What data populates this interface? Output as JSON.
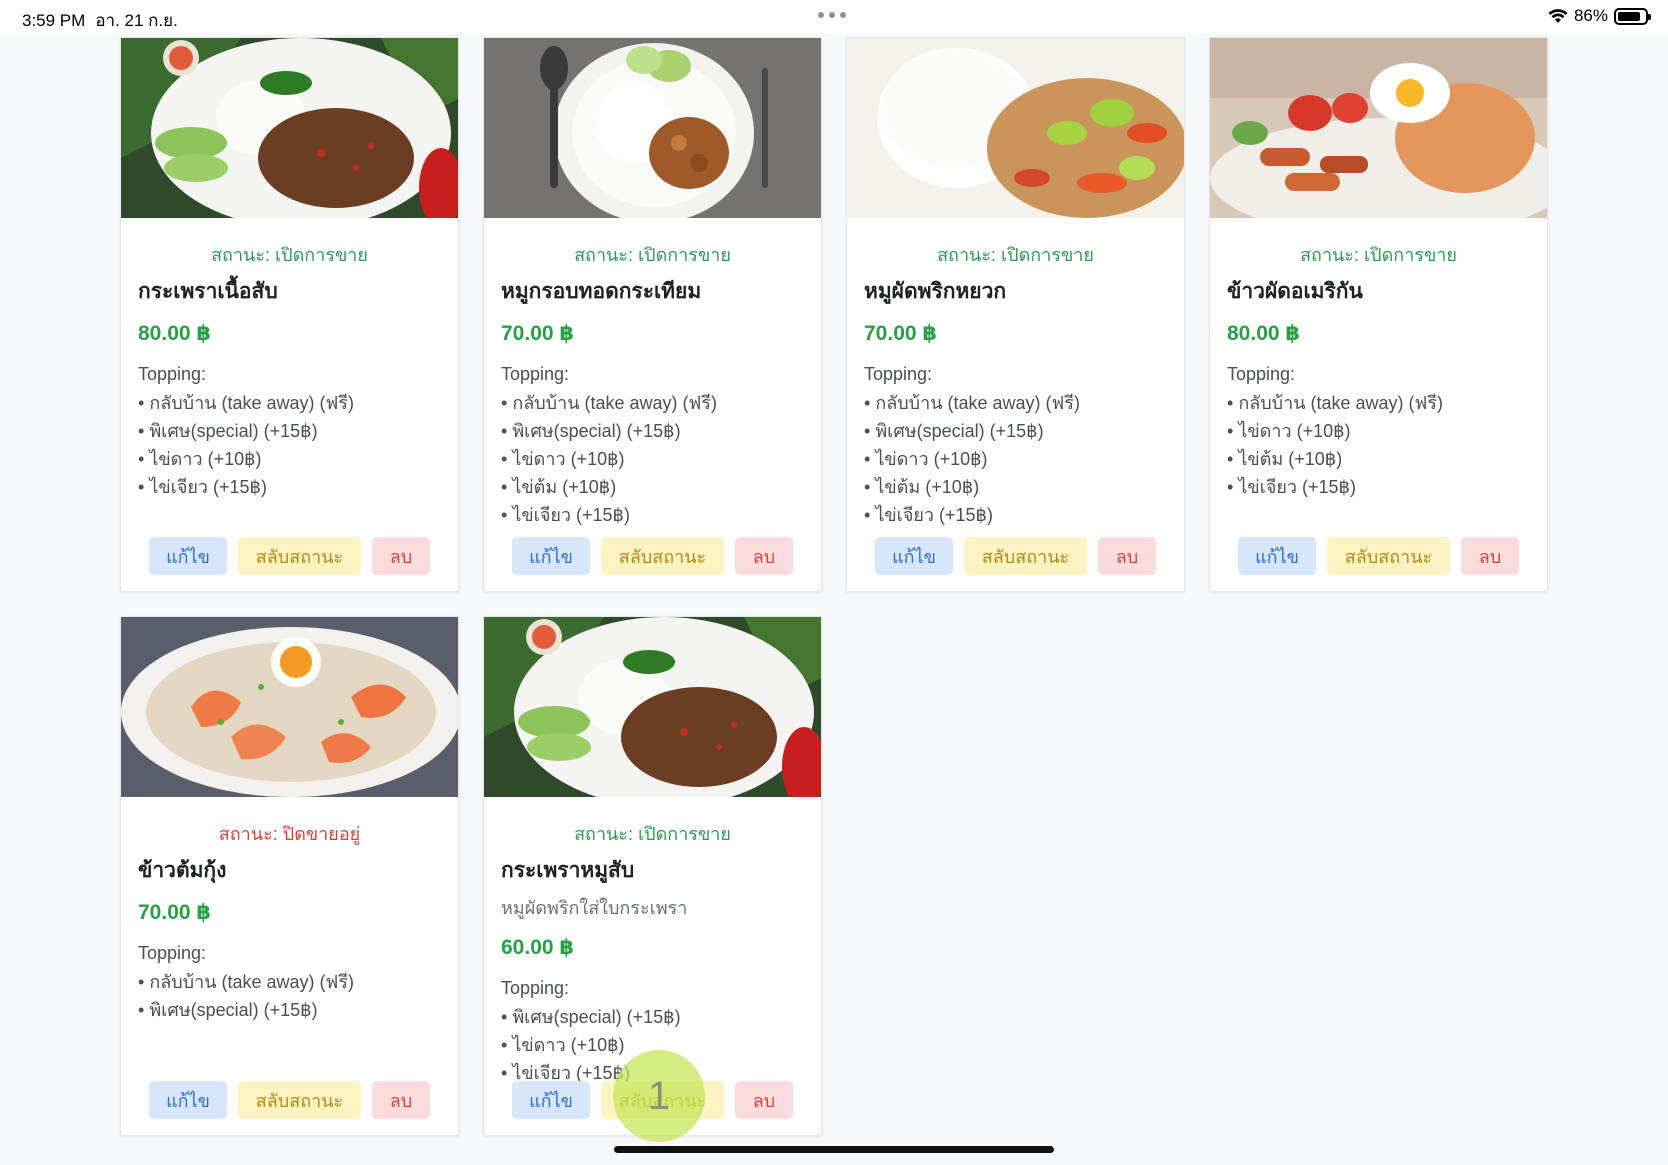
{
  "status_bar": {
    "time": "3:59 PM",
    "date": "อา. 21 ก.ย.",
    "battery": "86%",
    "battery_level": 0.86
  },
  "labels": {
    "topping": "Topping:",
    "edit": "แก้ไข",
    "toggle": "สลับสถานะ",
    "delete": "ลบ"
  },
  "menu_items": [
    {
      "status": "สถานะ: เปิดการขาย",
      "name": "กระเพราเนื้อสับ",
      "price": "80.00 ฿",
      "toppings": [
        "กลับบ้าน (take away) (ฟรี)",
        "พิเศษ(special) (+15฿)",
        "ไข่ดาว (+10฿)",
        "ไข่เจียว (+15฿)"
      ]
    },
    {
      "status": "สถานะ: เปิดการขาย",
      "name": "หมูกรอบทอดกระเทียม",
      "price": "70.00 ฿",
      "toppings": [
        "กลับบ้าน (take away) (ฟรี)",
        "พิเศษ(special) (+15฿)",
        "ไข่ดาว (+10฿)",
        "ไข่ต้ม (+10฿)",
        "ไข่เจียว (+15฿)"
      ]
    },
    {
      "status": "สถานะ: เปิดการขาย",
      "name": "หมูผัดพริกหยวก",
      "price": "70.00 ฿",
      "toppings": [
        "กลับบ้าน (take away) (ฟรี)",
        "พิเศษ(special) (+15฿)",
        "ไข่ดาว (+10฿)",
        "ไข่ต้ม (+10฿)",
        "ไข่เจียว (+15฿)"
      ]
    },
    {
      "status": "สถานะ: เปิดการขาย",
      "name": "ข้าวผัดอเมริกัน",
      "price": "80.00 ฿",
      "toppings": [
        "กลับบ้าน (take away) (ฟรี)",
        "ไข่ดาว (+10฿)",
        "ไข่ต้ม (+10฿)",
        "ไข่เจียว (+15฿)"
      ]
    },
    {
      "status": "สถานะ: ปิดขายอยู่",
      "name": "ข้าวต้มกุ้ง",
      "price": "70.00 ฿",
      "toppings": [
        "กลับบ้าน (take away) (ฟรี)",
        "พิเศษ(special) (+15฿)"
      ]
    },
    {
      "status": "สถานะ: เปิดการขาย",
      "name": "กระเพราหมูสับ",
      "description": "หมูผัดพริกใส่ใบกระเพรา",
      "price": "60.00 ฿",
      "toppings": [
        "พิเศษ(special) (+15฿)",
        "ไข่ดาว (+10฿)",
        "ไข่เจียว (+15฿)"
      ]
    }
  ],
  "touch_indicator": "1",
  "colors": {
    "open_status": "#2e9a52",
    "closed_status": "#d9423b",
    "price": "#27a046",
    "edit_bg": "#d7e6fb",
    "toggle_bg": "#fdf2c2",
    "delete_bg": "#fbdcdd"
  }
}
